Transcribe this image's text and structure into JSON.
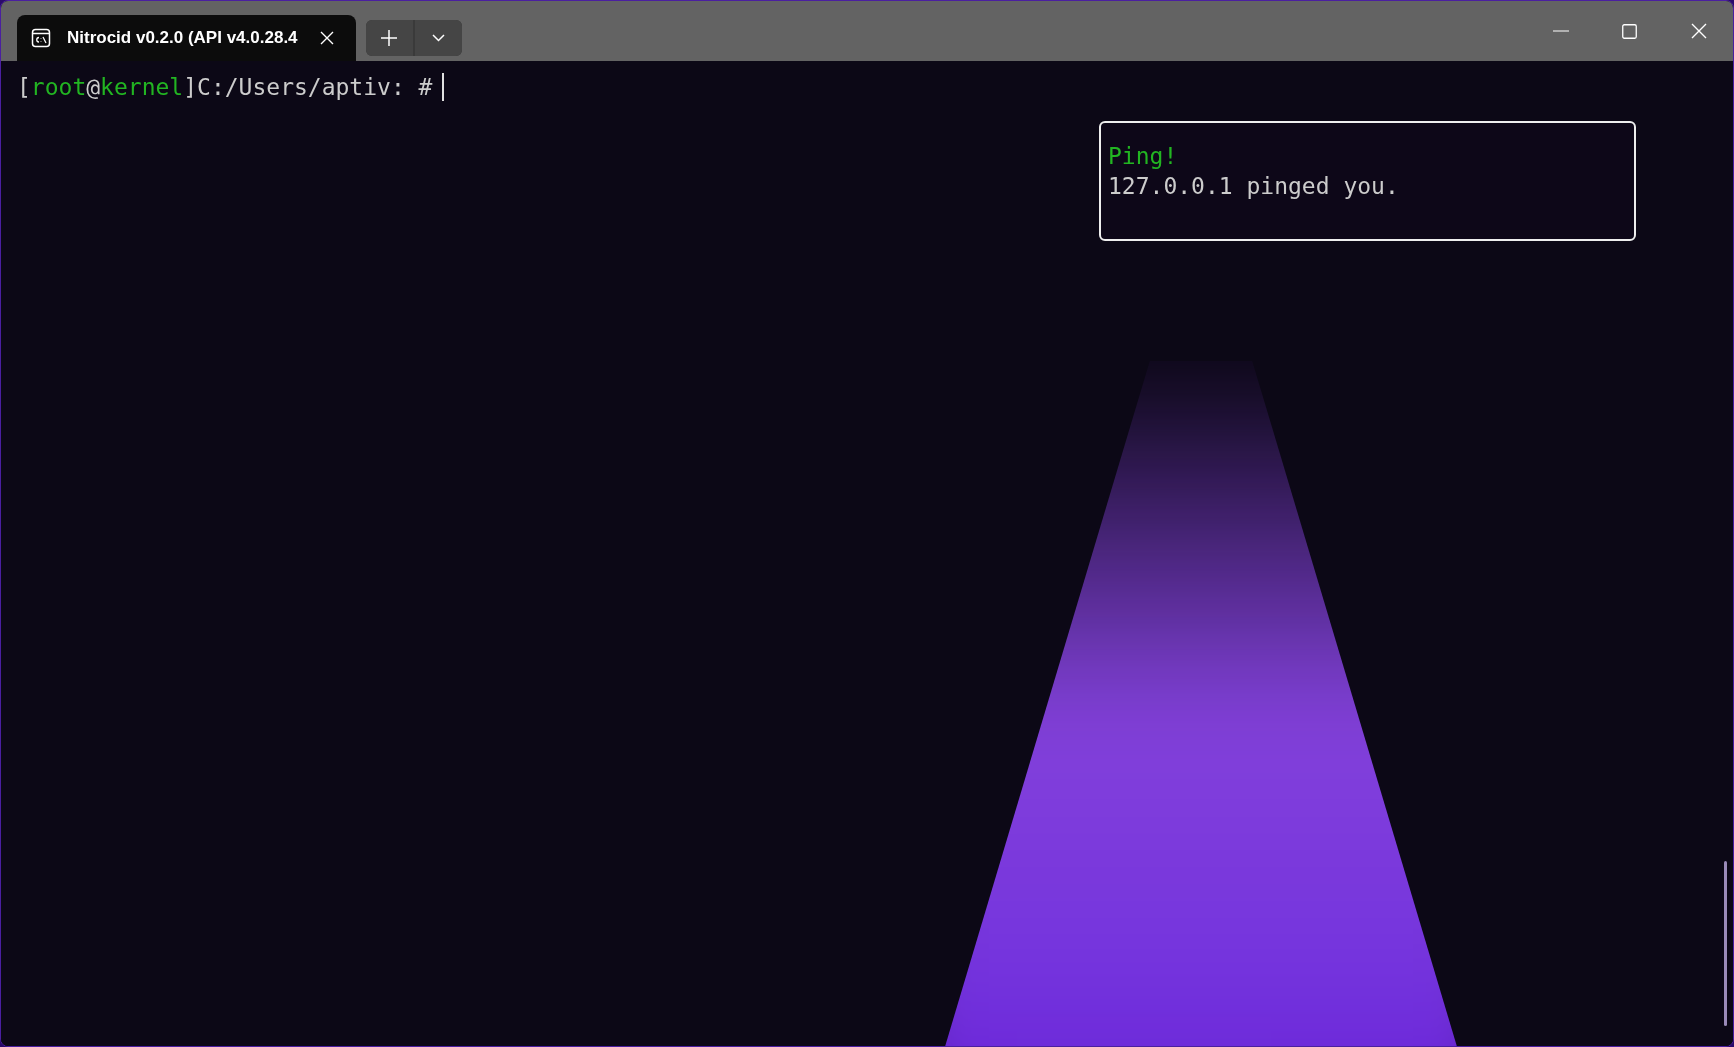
{
  "tabs": [
    {
      "title": "Nitrocid v0.2.0 (API v4.0.28.4",
      "selected": true
    }
  ],
  "terminal": {
    "prompt": [
      {
        "text": "[",
        "kind": "plain"
      },
      {
        "text": "root",
        "kind": "accent"
      },
      {
        "text": "@",
        "kind": "plain"
      },
      {
        "text": "kernel",
        "kind": "accent"
      },
      {
        "text": "]C:/Users/aptiv: #",
        "kind": "plain"
      }
    ]
  },
  "notification": {
    "title": "Ping!",
    "message": "127.0.0.1 pinged you."
  }
}
